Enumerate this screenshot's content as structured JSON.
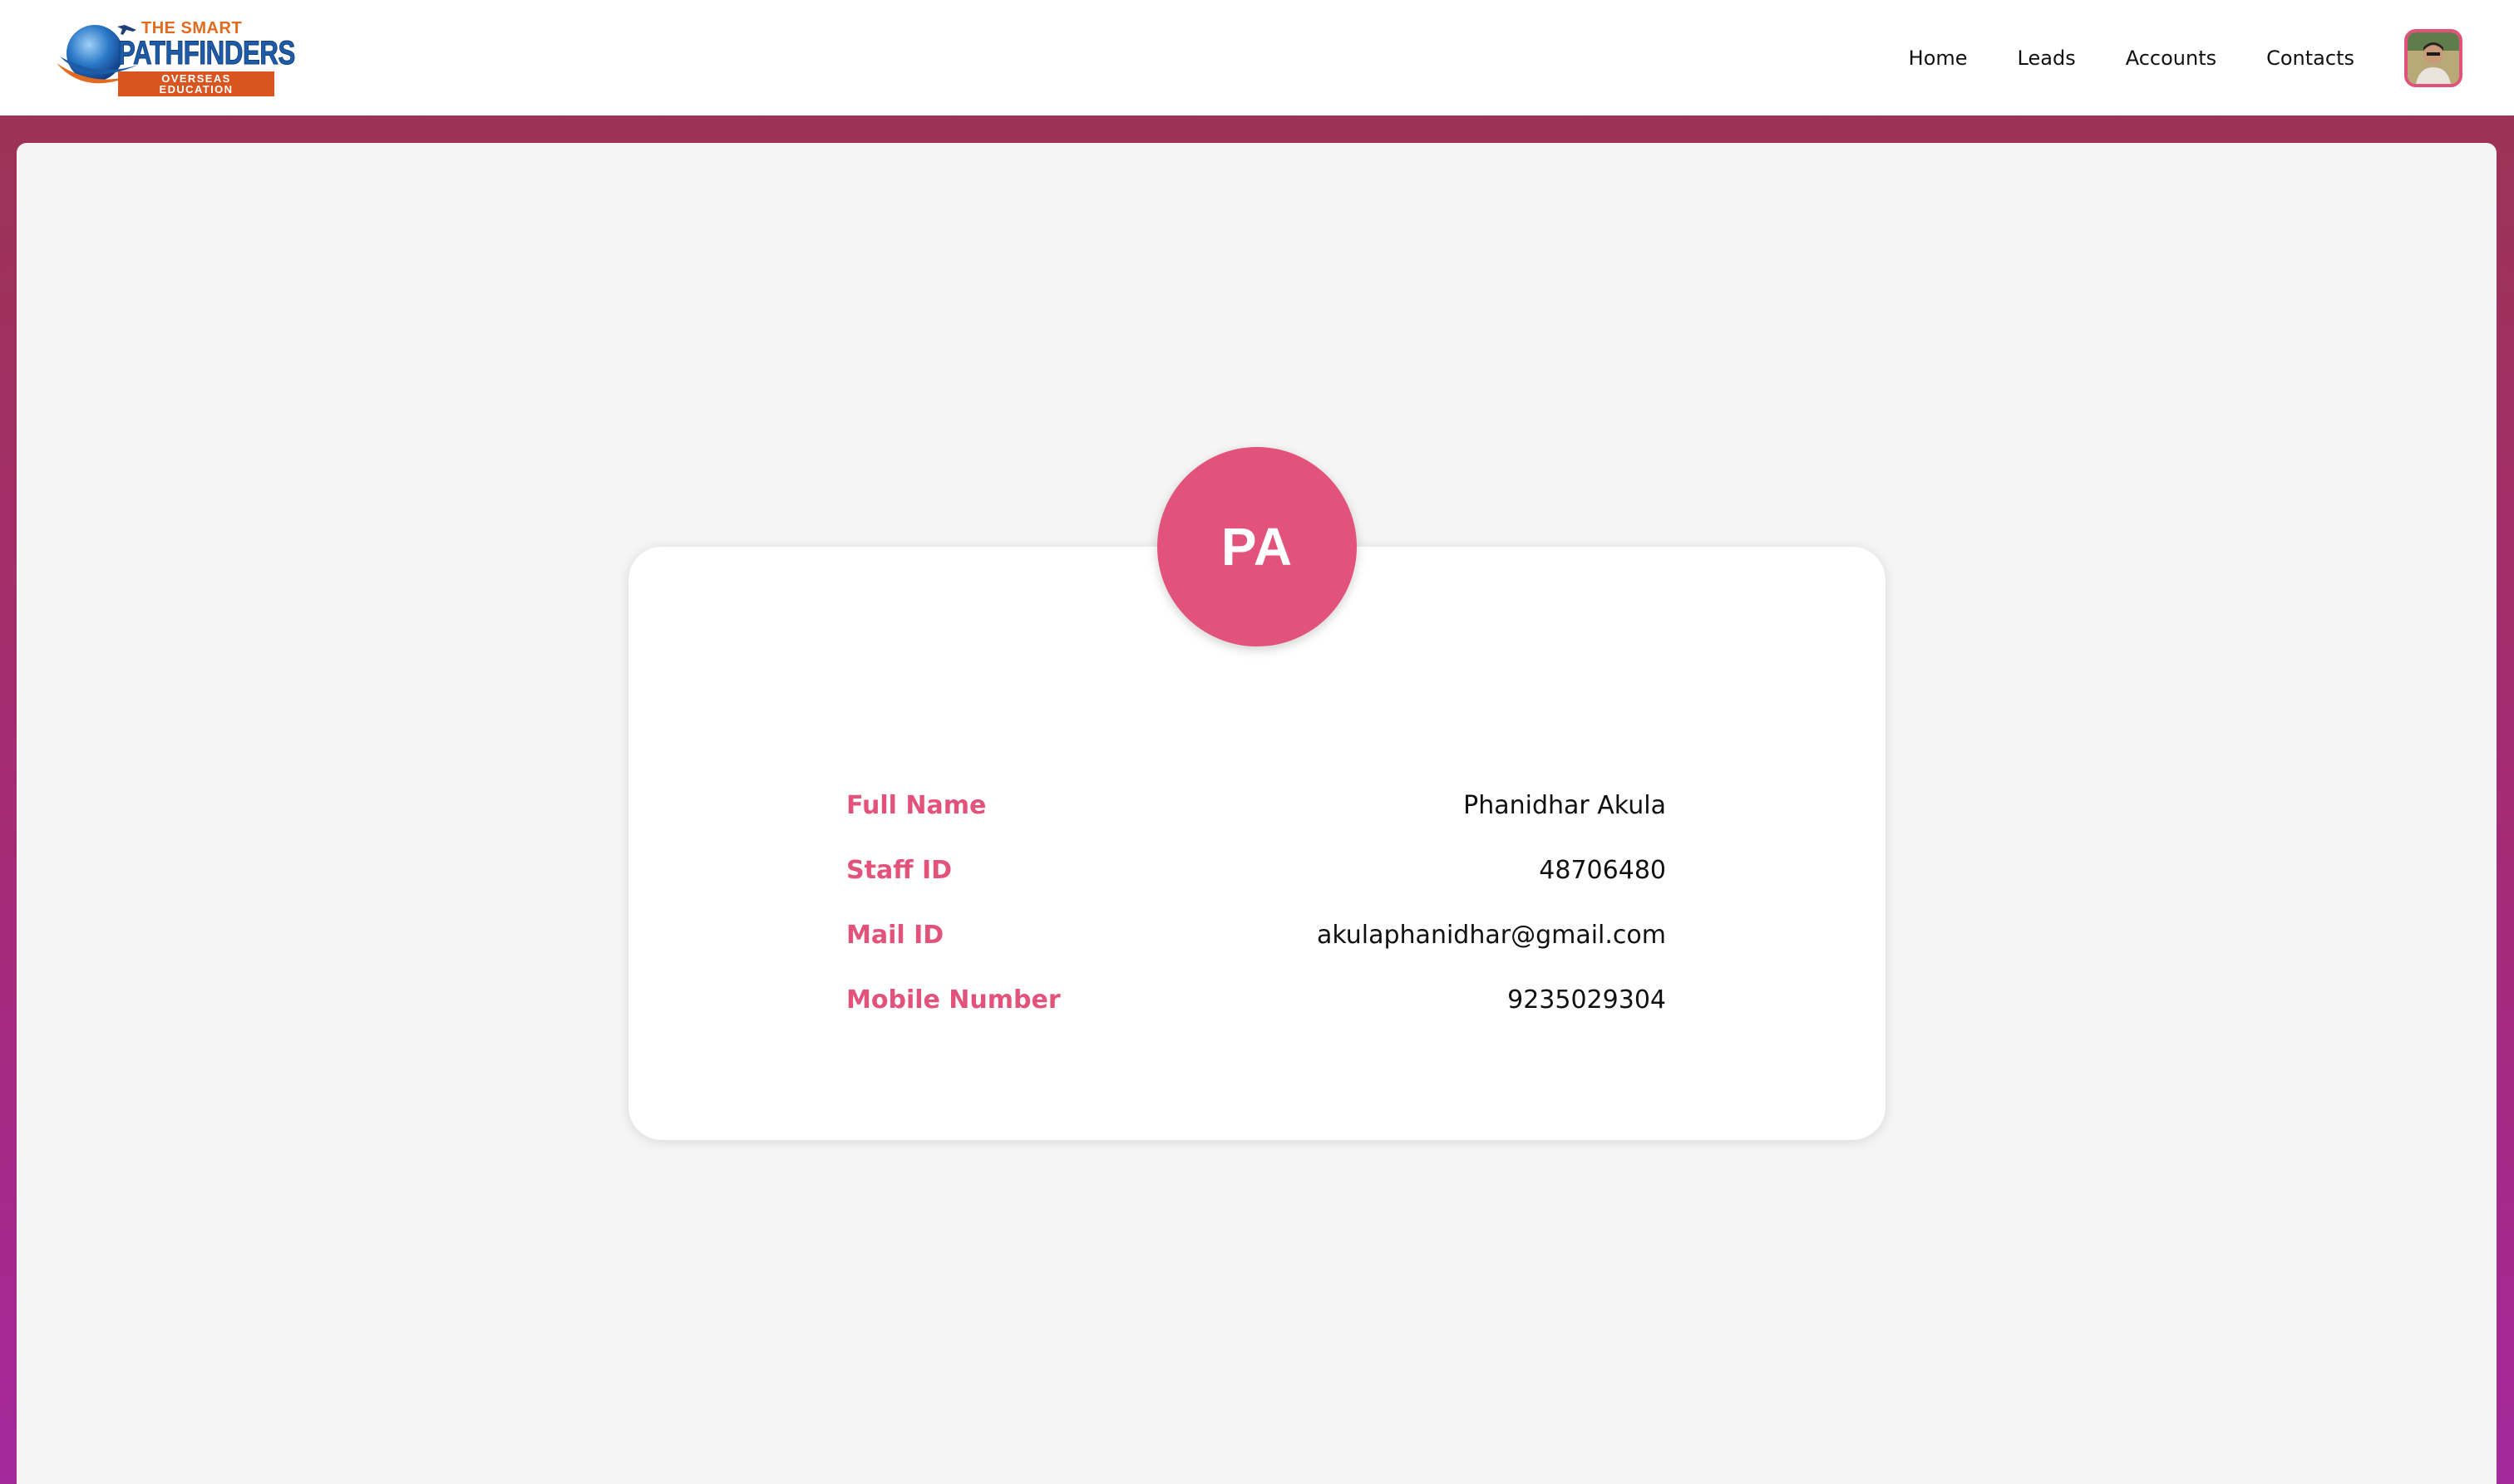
{
  "header": {
    "logo": {
      "top_text": "THE SMART",
      "main_text": "PATHFINDERS",
      "sub_text": "OVERSEAS EDUCATION"
    },
    "nav": [
      {
        "label": "Home"
      },
      {
        "label": "Leads"
      },
      {
        "label": "Accounts"
      },
      {
        "label": "Contacts"
      }
    ]
  },
  "profile": {
    "initials": "PA",
    "fields": [
      {
        "label": "Full Name",
        "value": "Phanidhar Akula"
      },
      {
        "label": "Staff ID",
        "value": "48706480"
      },
      {
        "label": "Mail ID",
        "value": "akulaphanidhar@gmail.com"
      },
      {
        "label": "Mobile Number",
        "value": "9235029304"
      }
    ]
  },
  "colors": {
    "accent": "#e2527a",
    "header_bg": "#ffffff",
    "page_gradient_top": "#9c3450",
    "page_gradient_bottom": "#a4299c",
    "panel_bg": "#f5f5f5"
  },
  "icons": {
    "logo": "globe-plane-logo",
    "user": "user-avatar-photo"
  }
}
